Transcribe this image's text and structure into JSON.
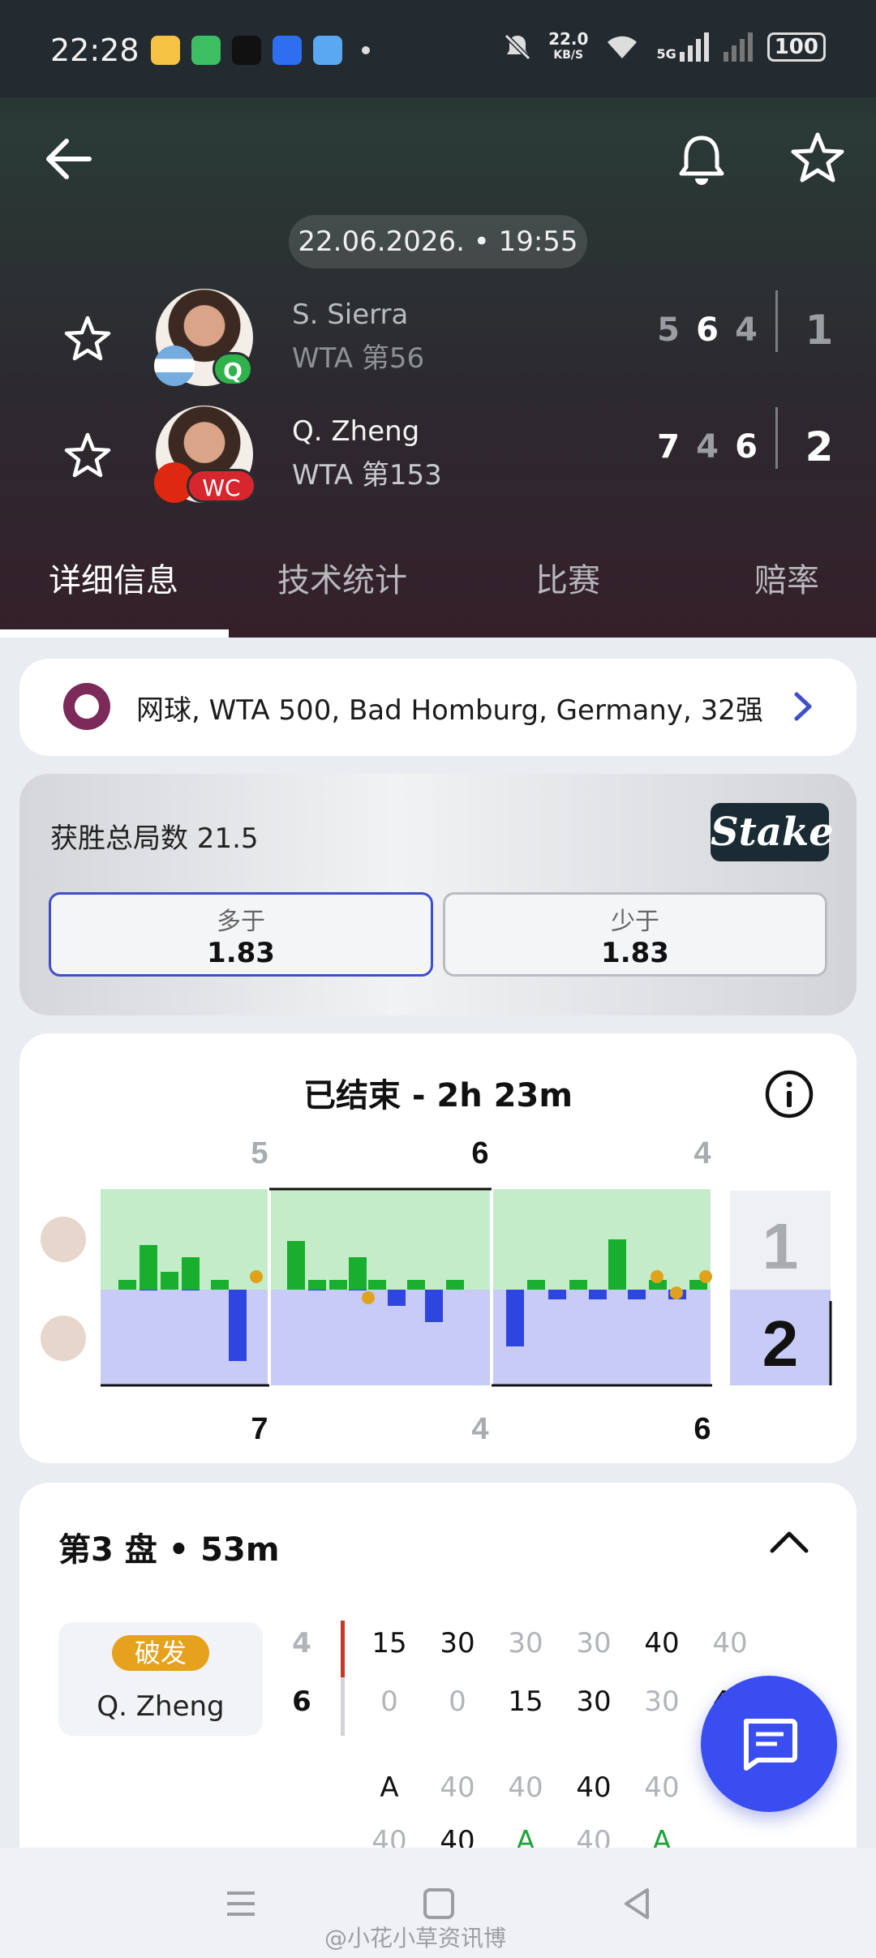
{
  "status_bar": {
    "time": "22:28",
    "speed_value": "22.0",
    "speed_unit": "KB/S",
    "network": "5G",
    "battery": "100"
  },
  "header": {
    "date_time": "22.06.2026. • 19:55",
    "players": [
      {
        "name": "S. Sierra",
        "rank": "WTA 第56",
        "flag": "argentina",
        "badge": "Q",
        "sets": [
          "5",
          "6",
          "4"
        ],
        "set_winner": [
          false,
          true,
          false
        ],
        "total": "1",
        "total_color": "#9a9da1"
      },
      {
        "name": "Q. Zheng",
        "rank": "WTA 第153",
        "flag": "china",
        "badge": "WC",
        "sets": [
          "7",
          "4",
          "6"
        ],
        "set_winner": [
          true,
          false,
          true
        ],
        "total": "2",
        "total_color": "#ffffff"
      }
    ]
  },
  "tabs": [
    {
      "label": "详细信息",
      "active": true
    },
    {
      "label": "技术统计",
      "active": false
    },
    {
      "label": "比赛",
      "active": false
    },
    {
      "label": "赔率",
      "active": false
    }
  ],
  "league": {
    "text": "网球, WTA 500, Bad Homburg, Germany, 32强"
  },
  "odds": {
    "title": "获胜总局数 21.5",
    "bookmaker": "Stake",
    "options": [
      {
        "label": "多于",
        "value": "1.83",
        "selected": true
      },
      {
        "label": "少于",
        "value": "1.83",
        "selected": false
      }
    ]
  },
  "timeline": {
    "title": "已结束 - 2h 23m",
    "top_scores": [
      "5",
      "6",
      "4"
    ],
    "bottom_scores": [
      "7",
      "4",
      "6"
    ],
    "top_winner": [
      false,
      true,
      false
    ],
    "bottom_winner": [
      true,
      false,
      true
    ],
    "set_totals": [
      "1",
      "2"
    ],
    "colors": {
      "top_fill": "#c4ecc8",
      "bottom_fill": "#c7cbf6",
      "top_bar": "#1aae2e",
      "bottom_bar": "#2f45e0",
      "break": "#e0a21a"
    },
    "games": [
      [
        1,
        0
      ],
      [
        0,
        1
      ],
      [
        1,
        0
      ],
      [
        0,
        1
      ],
      [
        1,
        0
      ],
      [
        0,
        1
      ],
      [
        1,
        0
      ],
      [
        0,
        1
      ],
      [
        1,
        0
      ],
      [
        0,
        1
      ],
      [
        1,
        0
      ],
      [
        0,
        1
      ]
    ]
  },
  "set3": {
    "title": "第3 盘 • 53m",
    "break_label": "破发",
    "break_player": "Q. Zheng",
    "score_top": "4",
    "score_bottom": "6",
    "row1": [
      "15",
      "30",
      "30",
      "30",
      "40",
      "40"
    ],
    "row2": [
      "0",
      "0",
      "15",
      "30",
      "30",
      "40"
    ],
    "row3": [
      "A",
      "40",
      "40",
      "40",
      "40"
    ],
    "row4": [
      "40",
      "40",
      "A",
      "40",
      "A"
    ]
  },
  "watermark": "@小花小草资讯博"
}
